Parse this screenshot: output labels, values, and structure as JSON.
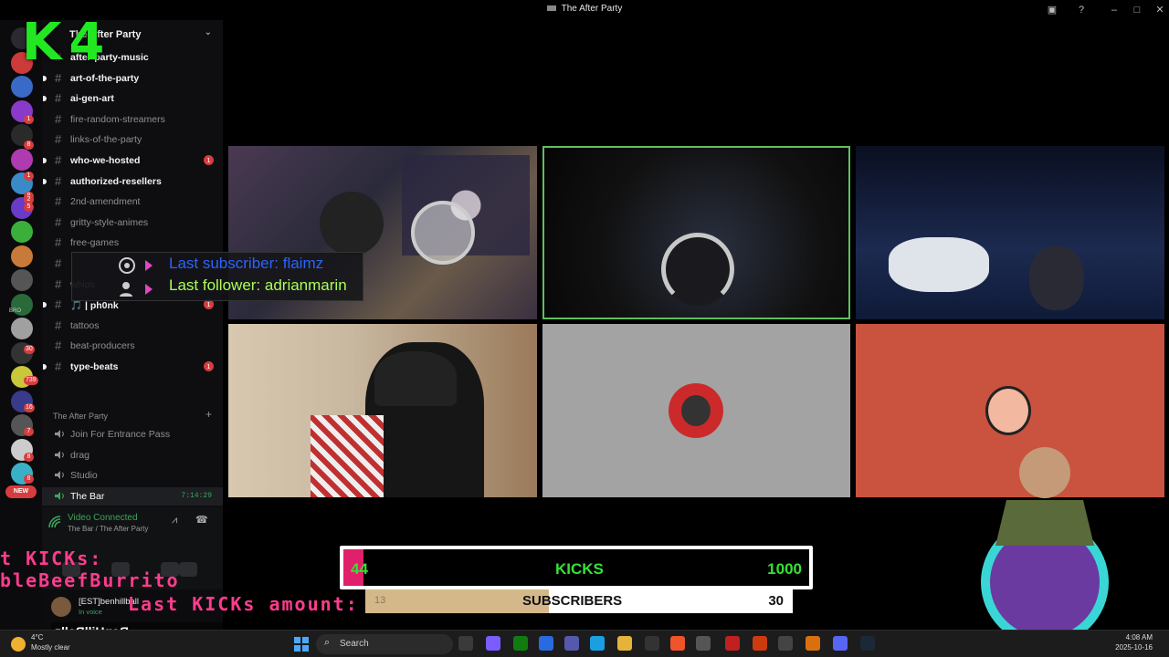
{
  "window": {
    "title": "The After Party"
  },
  "overlay": {
    "k4_label": "K4",
    "last_subscriber": "Last subscriber: flaimz",
    "last_follower": "Last follower: adrianmarin",
    "kicks": {
      "current": "44",
      "label": "KICKS",
      "goal": "1000",
      "progress": 0.044
    },
    "subscribers": {
      "current": "13",
      "label": "SUBSCRIBERS",
      "goal": "30",
      "progress": 0.43
    },
    "pink_lines": [
      "t KICKs:",
      "bleBeefBurrito"
    ],
    "pink_amount": "Last KICKs amount:",
    "social_handle": "BenHillBallz"
  },
  "rail": {
    "badges": [
      "1",
      "8",
      "1",
      "8",
      "2",
      "5",
      "30",
      "739",
      "16",
      "7",
      "8",
      "8",
      "2"
    ],
    "new_label": "NEW",
    "folder_label": "BRO"
  },
  "sidebar": {
    "server_name": "The After Party",
    "channels": [
      {
        "name": "after-party-music",
        "bold": true,
        "unread": false,
        "badge": ""
      },
      {
        "name": "art-of-the-party",
        "bold": true,
        "unread": true,
        "badge": ""
      },
      {
        "name": "ai-gen-art",
        "bold": true,
        "unread": true,
        "badge": ""
      },
      {
        "name": "fire-random-streamers",
        "bold": false,
        "unread": false,
        "badge": ""
      },
      {
        "name": "links-of-the-party",
        "bold": false,
        "unread": false,
        "badge": ""
      },
      {
        "name": "who-we-hosted",
        "bold": true,
        "unread": true,
        "badge": "1"
      },
      {
        "name": "authorized-resellers",
        "bold": true,
        "unread": true,
        "badge": ""
      },
      {
        "name": "2nd-amendment",
        "bold": false,
        "unread": false,
        "badge": ""
      },
      {
        "name": "gritty-style-animes",
        "bold": false,
        "unread": false,
        "badge": ""
      },
      {
        "name": "free-games",
        "bold": false,
        "unread": false,
        "badge": ""
      },
      {
        "name": "",
        "bold": false,
        "unread": false,
        "badge": ""
      },
      {
        "name": "whips",
        "bold": false,
        "unread": false,
        "badge": ""
      },
      {
        "name": "🎵 | ph0nk",
        "bold": true,
        "unread": true,
        "badge": "1"
      },
      {
        "name": "tattoos",
        "bold": false,
        "unread": false,
        "badge": ""
      },
      {
        "name": "beat-producers",
        "bold": false,
        "unread": false,
        "badge": ""
      },
      {
        "name": "type-beats",
        "bold": true,
        "unread": true,
        "badge": "1"
      }
    ],
    "voice_category": "The After Party",
    "voice_channels": [
      {
        "name": "Join For Entrance Pass",
        "timer": ""
      },
      {
        "name": "drag",
        "timer": ""
      },
      {
        "name": "Studio",
        "timer": ""
      },
      {
        "name": "The Bar",
        "timer": "7:14:29"
      }
    ],
    "voice_status": "Video Connected",
    "voice_location": "The Bar / The After Party",
    "user": {
      "name": "[EST]benhillball",
      "status": "In voice"
    }
  },
  "taskbar": {
    "temperature": "4°C",
    "weather": "Mostly clear",
    "search_label": "Search",
    "time": "4:08 AM",
    "date": "2025-10-16"
  },
  "colors": {
    "accent_green": "#3ba55d",
    "badge_red": "#d83c3e",
    "kicks_green": "#35e135",
    "kicks_pink": "#e0206a",
    "follower_blue": "#2c63ff",
    "follower_green": "#aaff55"
  }
}
